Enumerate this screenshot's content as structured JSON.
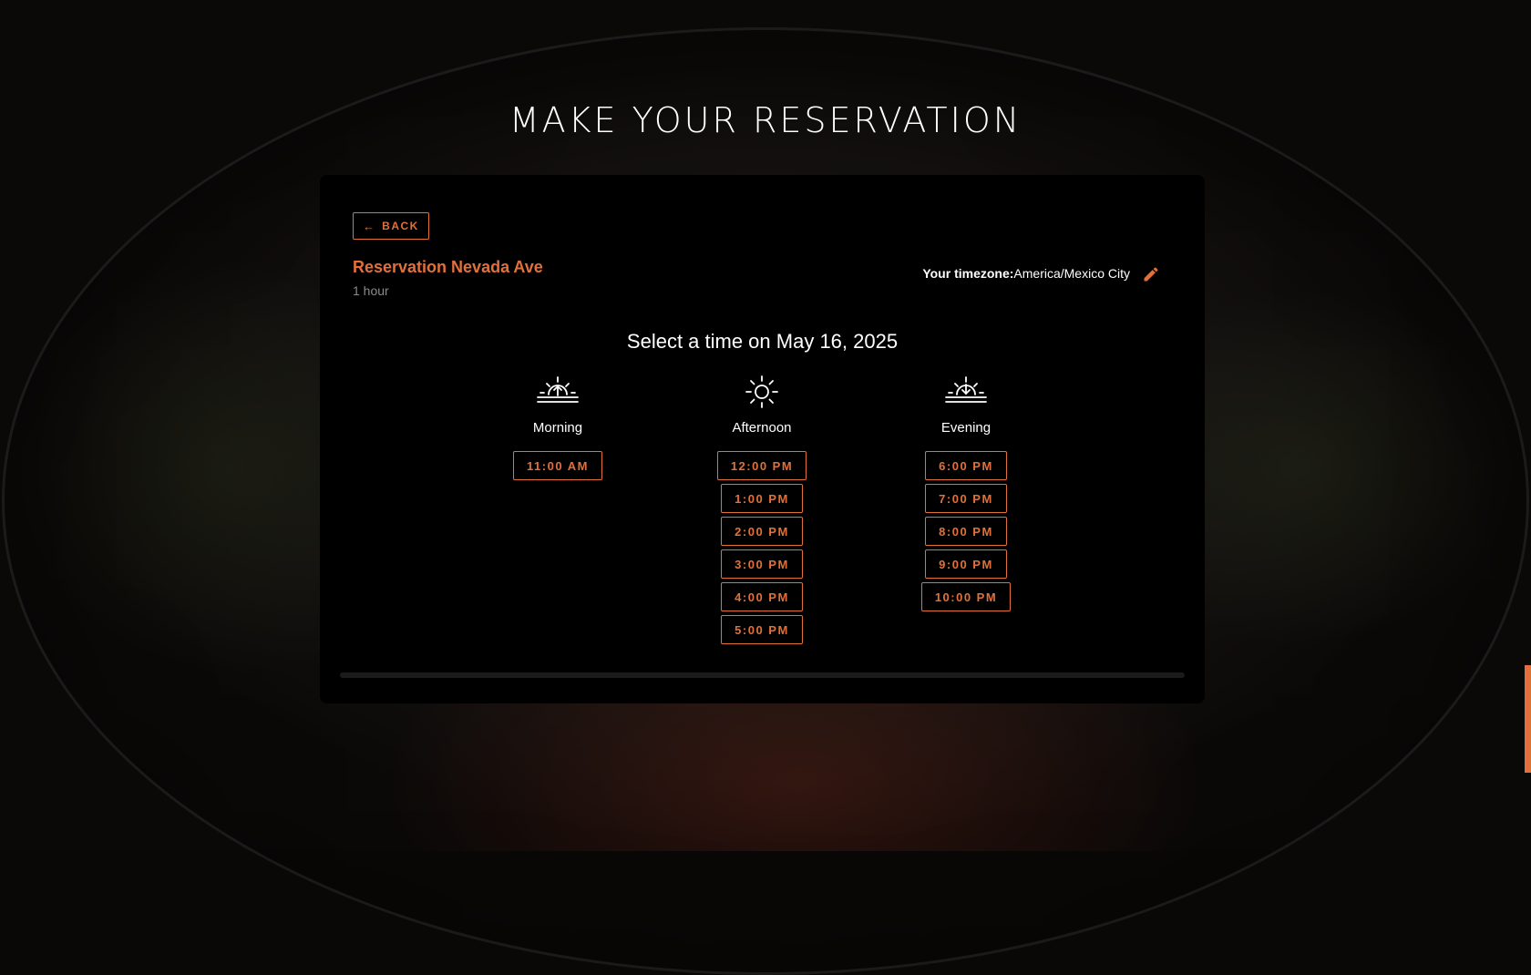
{
  "page": {
    "title": "MAKE YOUR RESERVATION"
  },
  "card": {
    "back_label": "BACK",
    "event_name": "Reservation Nevada Ave",
    "duration": "1 hour",
    "timezone_label": "Your timezone:",
    "timezone_value": "America/Mexico City",
    "select_heading": "Select a time on May 16, 2025"
  },
  "columns": {
    "morning": {
      "label": "Morning",
      "icon": "sunrise-icon",
      "slots": [
        "11:00 AM"
      ]
    },
    "afternoon": {
      "label": "Afternoon",
      "icon": "sun-icon",
      "slots": [
        "12:00 PM",
        "1:00 PM",
        "2:00 PM",
        "3:00 PM",
        "4:00 PM",
        "5:00 PM"
      ]
    },
    "evening": {
      "label": "Evening",
      "icon": "sunset-icon",
      "slots": [
        "6:00 PM",
        "7:00 PM",
        "8:00 PM",
        "9:00 PM",
        "10:00 PM"
      ]
    }
  },
  "colors": {
    "accent": "#e2703a",
    "card_background": "#000000",
    "text": "#ffffff",
    "muted": "#8a8a8a"
  }
}
